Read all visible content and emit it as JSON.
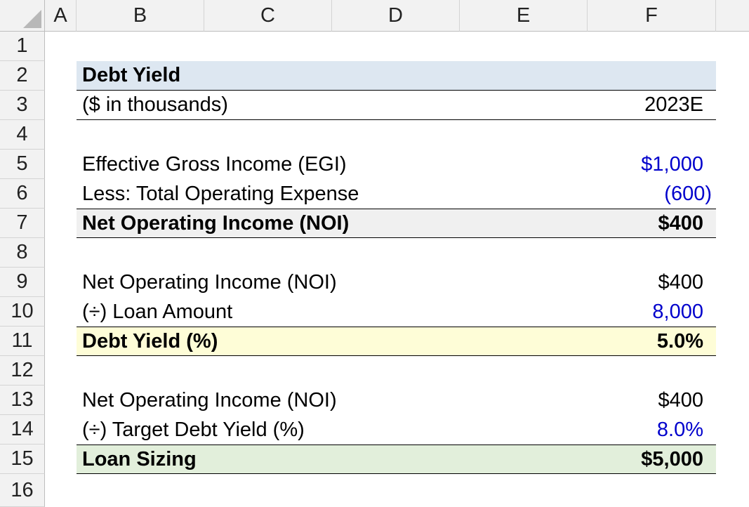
{
  "columns": [
    "A",
    "B",
    "C",
    "D",
    "E",
    "F"
  ],
  "row_numbers": [
    "1",
    "2",
    "3",
    "4",
    "5",
    "6",
    "7",
    "8",
    "9",
    "10",
    "11",
    "12",
    "13",
    "14",
    "15",
    "16"
  ],
  "table": {
    "title": "Debt Yield",
    "units_label": "($ in thousands)",
    "period": "2023E",
    "egi_label": "Effective Gross Income (EGI)",
    "egi_value": "$1,000",
    "opex_label": "Less: Total Operating Expense",
    "opex_value": "(600)",
    "noi_total_label": "Net Operating Income (NOI)",
    "noi_total_value": "$400",
    "noi_label_2": "Net Operating Income (NOI)",
    "noi_value_2": "$400",
    "loan_amount_label": "(÷) Loan Amount",
    "loan_amount_value": "8,000",
    "debt_yield_label": "Debt Yield (%)",
    "debt_yield_value": "5.0%",
    "noi_label_3": "Net Operating Income (NOI)",
    "noi_value_3": "$400",
    "target_yield_label": "(÷) Target Debt Yield (%)",
    "target_yield_value": "8.0%",
    "loan_sizing_label": "Loan Sizing",
    "loan_sizing_value": "$5,000"
  },
  "colors": {
    "input_blue": "#0000cc",
    "header_fill": "#dde7f1",
    "total_fill": "#f0f0f0",
    "yield_fill": "#fefdd7",
    "sizing_fill": "#e2efdb"
  }
}
